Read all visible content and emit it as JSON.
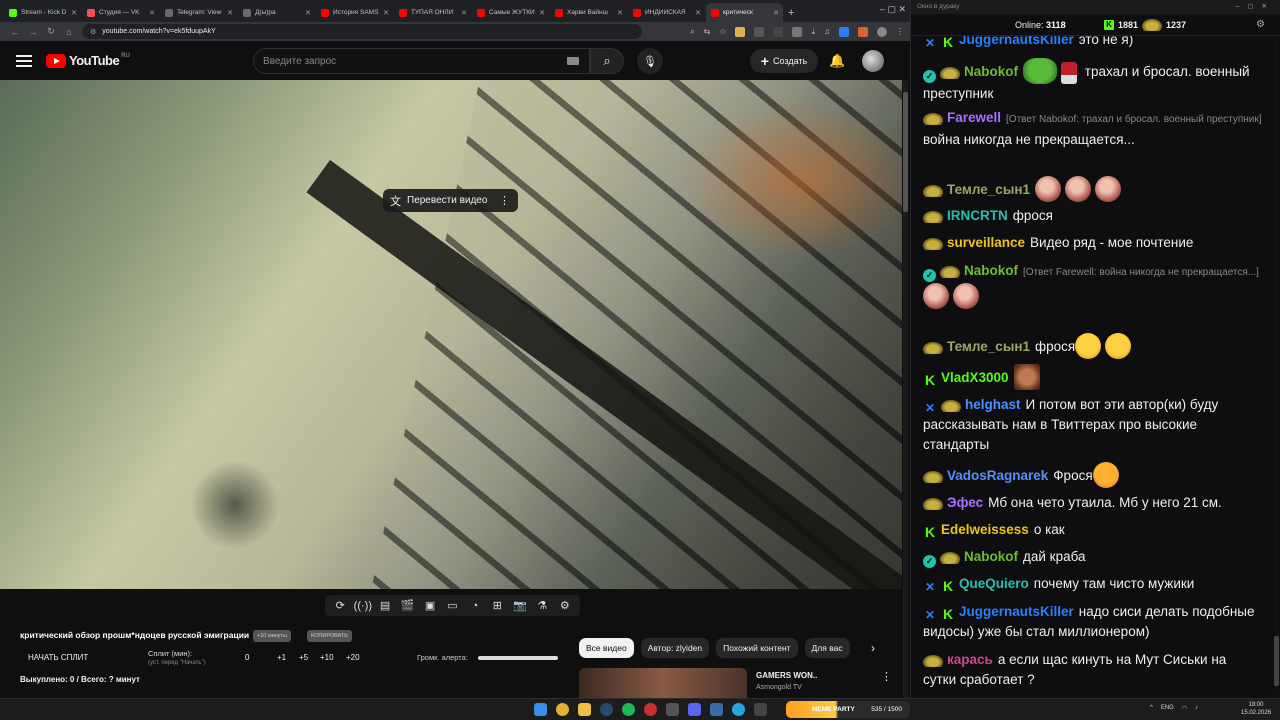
{
  "browser": {
    "tabs": [
      {
        "title": "Stream - Kick D",
        "color": "#53fc18"
      },
      {
        "title": "Студия — VK",
        "color": "#ff4a5a"
      },
      {
        "title": "Telegram: View",
        "color": "#6a6a6a"
      },
      {
        "title": "Д(ы)ра",
        "color": "#6a6a6a"
      },
      {
        "title": "История SAMS",
        "color": "#ff0000"
      },
      {
        "title": "ТУПАЯ ОНЛИ",
        "color": "#ff0000"
      },
      {
        "title": "Самые ЖУТКИ",
        "color": "#ff0000"
      },
      {
        "title": "Харви Вайнш",
        "color": "#ff0000"
      },
      {
        "title": "ИНДИЙСКАЯ",
        "color": "#ff0000"
      },
      {
        "title": "критическ",
        "color": "#ff0000",
        "active": true
      }
    ],
    "new_tab": "+",
    "win_controls": "–  ▢  ✕",
    "url": "youtube.com/watch?v=ek5fduupAkY"
  },
  "yt": {
    "logo": "YouTube",
    "region": "RU",
    "search_placeholder": "Введите запрос",
    "create_label": "Создать",
    "translate_label": "Перевести видео",
    "video_title": "критический обзор прошм*ндоцев русской эмиграции",
    "chip1": "+10 минуты",
    "chip2": "КОПИРОВАТЬ",
    "start_split": "НАЧАТЬ СПЛИТ",
    "split_label": "Сплит (мин):",
    "split_sub": "(уст. перед \"Начать\")",
    "split_values": [
      "0",
      "+1",
      "+5",
      "+10",
      "+20"
    ],
    "alert_label": "Громк. алерта:",
    "sold": "Выкуплено: 0 / Всего: ? минут",
    "filters": [
      "Все видео",
      "Автор: zlyiden",
      "Похожий контент",
      "Для вас"
    ],
    "rec_title": "GAMERS WON..",
    "rec_channel": "Asmongold TV"
  },
  "chat": {
    "window_title": "Окно в дураку",
    "online_label": "Online:",
    "online_count": "3118",
    "kick_count": "1881",
    "hat_count": "1237",
    "messages": [
      {
        "user": "JuggernautsKiller",
        "color": "#2a7fff",
        "text": "это не я)"
      },
      {
        "user": "Nabokof",
        "color": "#6dbb3a",
        "text": "трахал и бросал. военный преступник"
      },
      {
        "user": "Farewell",
        "color": "#a970ff",
        "reply": "[Ответ Nabokof: трахал и бросал. военный преступник]",
        "text": "война никогда не прекращается..."
      },
      {
        "user": "Темле_сын1",
        "color": "#9aa66a",
        "text": ""
      },
      {
        "user": "IRNCRTN",
        "color": "#22c3a8",
        "text": "фрося"
      },
      {
        "user": "surveillance",
        "color": "#f0c419",
        "text": "Видео ряд - мое почтение"
      },
      {
        "user": "Nabokof",
        "color": "#6dbb3a",
        "reply": "[Ответ Farewell: война никогда не прекращается...]",
        "text": ""
      },
      {
        "user": "Темле_сын1",
        "color": "#9aa66a",
        "text": "фрося"
      },
      {
        "user": "VladX3000",
        "color": "#53fc18",
        "text": ""
      },
      {
        "user": "helghast",
        "color": "#4a90ff",
        "text": "И потом вот эти автор(ки) буду рассказывать нам в Твиттерах про высокие стандарты"
      },
      {
        "user": "VadosRagnarek",
        "color": "#5a8fff",
        "text": "Фрося"
      },
      {
        "user": "Эфес",
        "color": "#a970ff",
        "text": "Мб она чето утаила. Мб у него 21 см."
      },
      {
        "user": "Edelweissess",
        "color": "#f0c419",
        "text": "о как"
      },
      {
        "user": "Nabokof",
        "color": "#6dbb3a",
        "text": "дай краба"
      },
      {
        "user": "QueQuiero",
        "color": "#22c3a8",
        "text": "почему там чисто мужики"
      },
      {
        "user": "JuggernautsKiller",
        "color": "#2a7fff",
        "text": "надо сиси делать подобные видосы) уже бы стал миллионером)"
      },
      {
        "user": "карась",
        "color": "#c94a8a",
        "text": "а если щас кинуть на Мут Сиськи на сутки сработает ?"
      }
    ]
  },
  "taskbar": {
    "meme_label": "MEME PARTY",
    "meme_count": "535 / 1500",
    "lang": "ENG",
    "time": "18:00",
    "date": "15.02.2026"
  }
}
